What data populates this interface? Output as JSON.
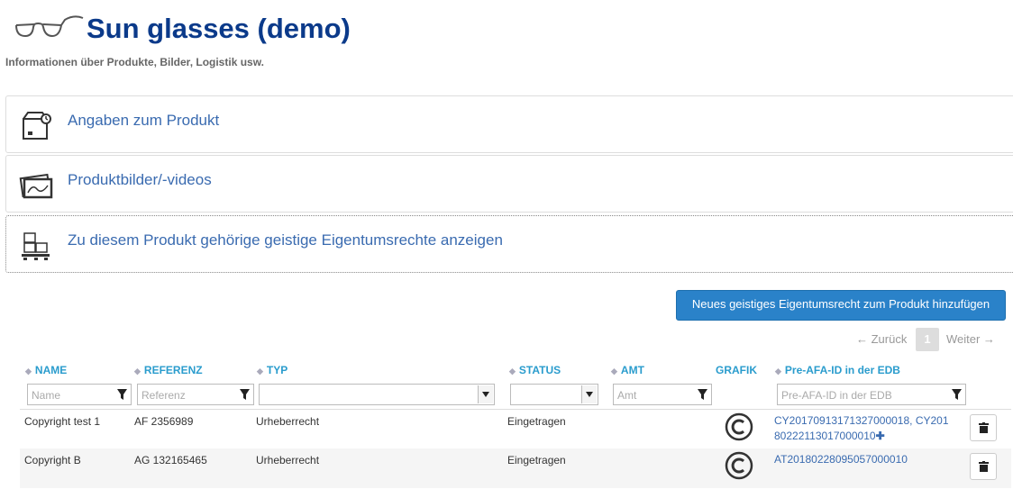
{
  "header": {
    "title": "Sun glasses (demo)",
    "subtitle": "Informationen über Produkte, Bilder, Logistik usw."
  },
  "panels": [
    {
      "label": "Angaben zum Produkt",
      "icon": "box-icon"
    },
    {
      "label": "Produktbilder/-videos",
      "icon": "photos-icon"
    },
    {
      "label": "Zu diesem Produkt gehörige geistige Eigentumsrechte anzeigen",
      "icon": "ipr-pallet-icon"
    }
  ],
  "ip_section": {
    "add_button": "Neues geistiges Eigentumsrecht zum Produkt hinzufügen",
    "pager": {
      "prev": "← Zurück",
      "page": "1",
      "next": "Weiter →"
    },
    "columns": {
      "name": "NAME",
      "reference": "REFERENZ",
      "type": "TYP",
      "status": "STATUS",
      "office": "AMT",
      "graphic": "GRAFIK",
      "pre_afa": "Pre-AFA-ID in der EDB"
    },
    "filters": {
      "name_placeholder": "Name",
      "reference_placeholder": "Referenz",
      "office_placeholder": "Amt",
      "pre_afa_placeholder": "Pre-AFA-ID in der EDB"
    },
    "rows": [
      {
        "name": "Copyright test 1",
        "reference": "AF 2356989",
        "type": "Urheberrecht",
        "status": "Eingetragen",
        "pre_afa_line1": "CY20170913171327000018, CY201",
        "pre_afa_line2": "80222113017000010"
      },
      {
        "name": "Copyright B",
        "reference": "AG 132165465",
        "type": "Urheberrecht",
        "status": "Eingetragen",
        "pre_afa_line1": "AT20180228095057000010"
      }
    ]
  },
  "colors": {
    "accent": "#2a82c9",
    "title": "#0b3a8a",
    "link": "#3a6bb0",
    "header_text": "#2a9ccd"
  }
}
